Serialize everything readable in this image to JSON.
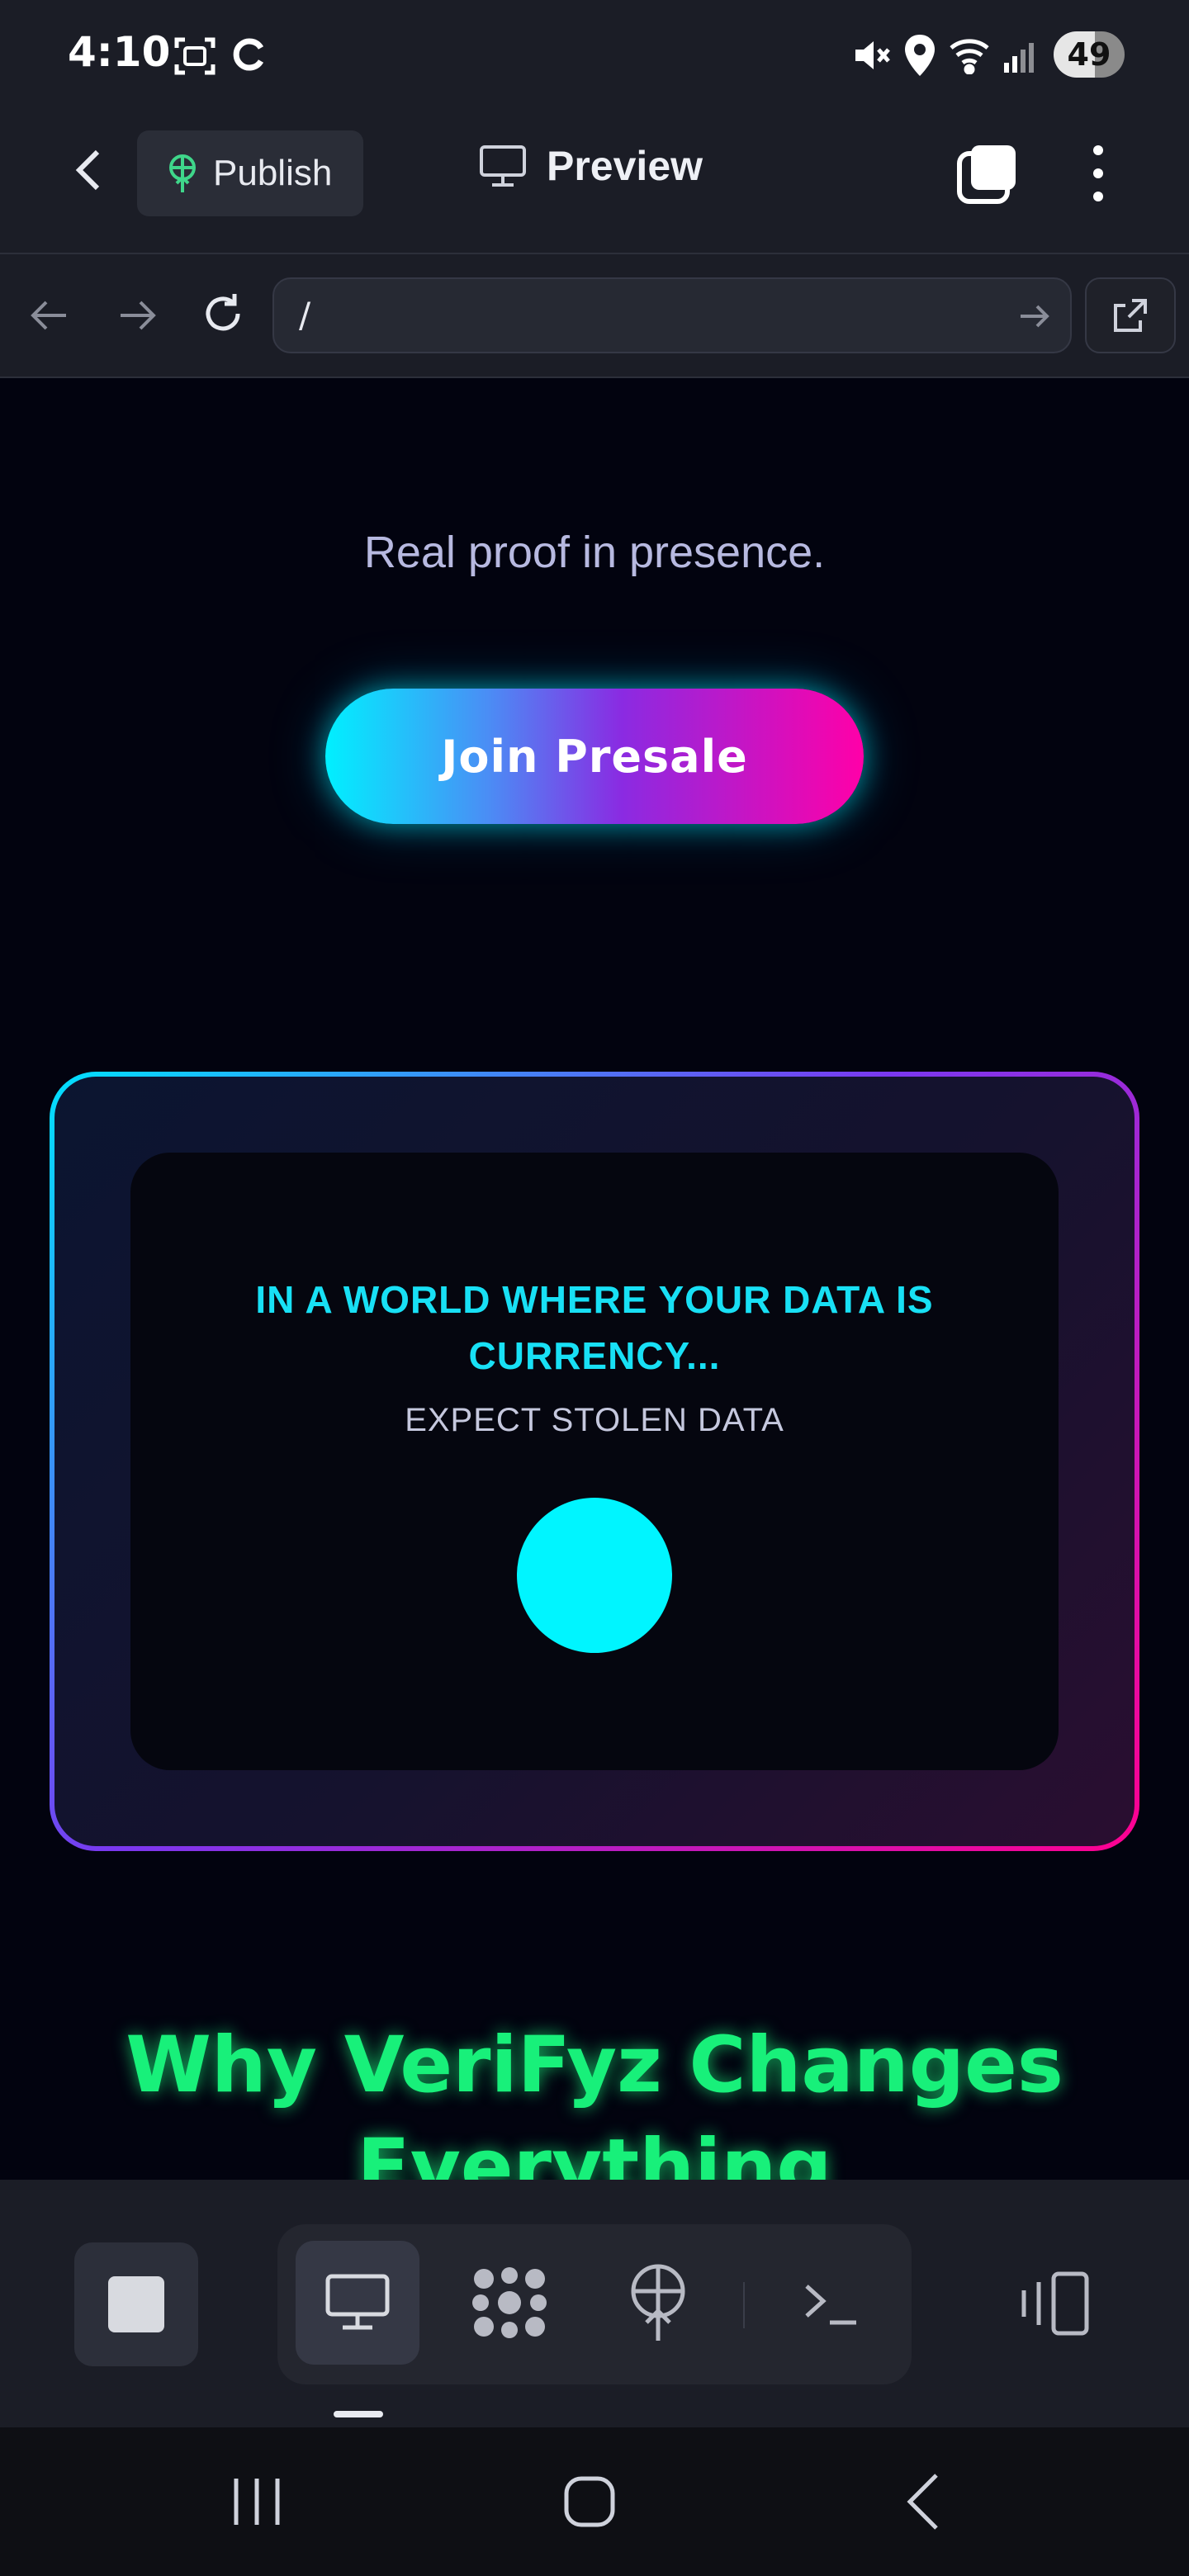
{
  "status_bar": {
    "time": "4:10",
    "battery": "49",
    "icons": [
      "screenshot-icon",
      "sync-icon",
      "mute-icon",
      "location-icon",
      "wifi-icon",
      "signal-icon"
    ]
  },
  "header": {
    "publish_label": "Publish",
    "title": "Preview"
  },
  "browser": {
    "url": "/"
  },
  "page": {
    "tagline": "Real proof in presence.",
    "cta_label": "Join Presale",
    "card": {
      "heading_line1": "IN A WORLD WHERE YOUR DATA IS",
      "heading_line2": "CURRENCY...",
      "subheading": "EXPECT STOLEN DATA"
    },
    "section_heading_line1": "Why VeriFyz Changes",
    "section_heading_line2": "Everything"
  },
  "colors": {
    "accent_cyan": "#00f0ff",
    "accent_magenta": "#ff00a8",
    "heading_green": "#18f07a",
    "page_bg": "#02030f",
    "chrome_bg": "#1b1d26"
  }
}
